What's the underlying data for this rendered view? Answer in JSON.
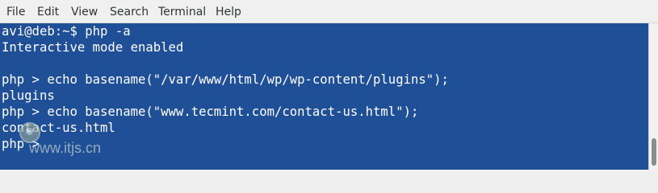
{
  "menubar": {
    "items": [
      "File",
      "Edit",
      "View",
      "Search",
      "Terminal",
      "Help"
    ]
  },
  "terminal": {
    "lines": [
      "avi@deb:~$ php -a",
      "Interactive mode enabled",
      "",
      "php > echo basename(\"/var/www/html/wp/wp-content/plugins\");",
      "plugins",
      "php > echo basename(\"www.tecmint.com/contact-us.html\");",
      "contact-us.html",
      "php > "
    ]
  },
  "watermark": {
    "url": "www.itjs.cn"
  },
  "colors": {
    "terminal_background": "#1f4f96",
    "terminal_foreground": "#ffffff",
    "menubar_background": "#f0f0f0"
  }
}
